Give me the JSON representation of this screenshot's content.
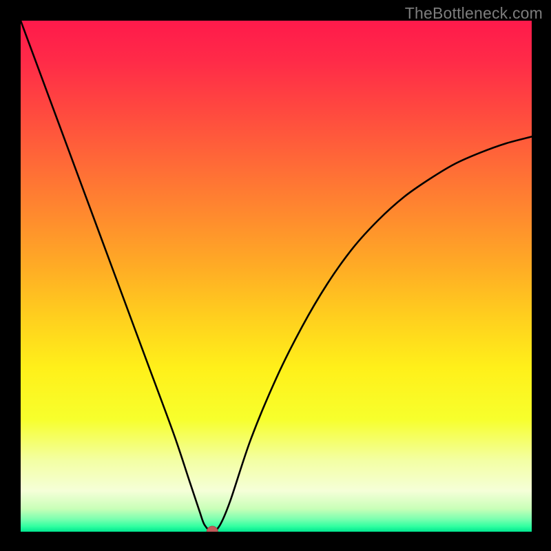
{
  "watermark": "TheBottleneck.com",
  "chart_data": {
    "type": "line",
    "title": "",
    "xlabel": "",
    "ylabel": "",
    "xlim": [
      0,
      100
    ],
    "ylim": [
      0,
      100
    ],
    "grid": false,
    "legend": false,
    "annotations": [],
    "marker": {
      "x": 37.5,
      "y": 0,
      "color": "#c15a5a",
      "radius_px": 8
    },
    "series": [
      {
        "name": "bottleneck-curve",
        "x": [
          0,
          5,
          10,
          15,
          20,
          25,
          30,
          33,
          35,
          36,
          37.5,
          39,
          41,
          45,
          50,
          55,
          60,
          65,
          70,
          75,
          80,
          85,
          90,
          95,
          100
        ],
        "y": [
          100,
          86.5,
          73,
          59.5,
          46,
          32.5,
          19,
          10,
          4,
          1.3,
          0,
          1.3,
          6,
          18,
          30,
          40,
          48.5,
          55.5,
          61,
          65.5,
          69,
          72,
          74.2,
          76,
          77.3
        ]
      }
    ],
    "background_gradient": {
      "stops": [
        {
          "pos": 0.0,
          "color": "#ff1a4b"
        },
        {
          "pos": 0.08,
          "color": "#ff2b48"
        },
        {
          "pos": 0.18,
          "color": "#ff4a3f"
        },
        {
          "pos": 0.28,
          "color": "#ff6a37"
        },
        {
          "pos": 0.38,
          "color": "#ff8a2e"
        },
        {
          "pos": 0.48,
          "color": "#ffab25"
        },
        {
          "pos": 0.58,
          "color": "#ffcf1e"
        },
        {
          "pos": 0.68,
          "color": "#fff01a"
        },
        {
          "pos": 0.78,
          "color": "#f7ff2c"
        },
        {
          "pos": 0.86,
          "color": "#f3ffa3"
        },
        {
          "pos": 0.92,
          "color": "#f5ffd8"
        },
        {
          "pos": 0.955,
          "color": "#c9ffb8"
        },
        {
          "pos": 0.975,
          "color": "#7dffb0"
        },
        {
          "pos": 0.99,
          "color": "#2effa0"
        },
        {
          "pos": 1.0,
          "color": "#00e58f"
        }
      ]
    }
  }
}
